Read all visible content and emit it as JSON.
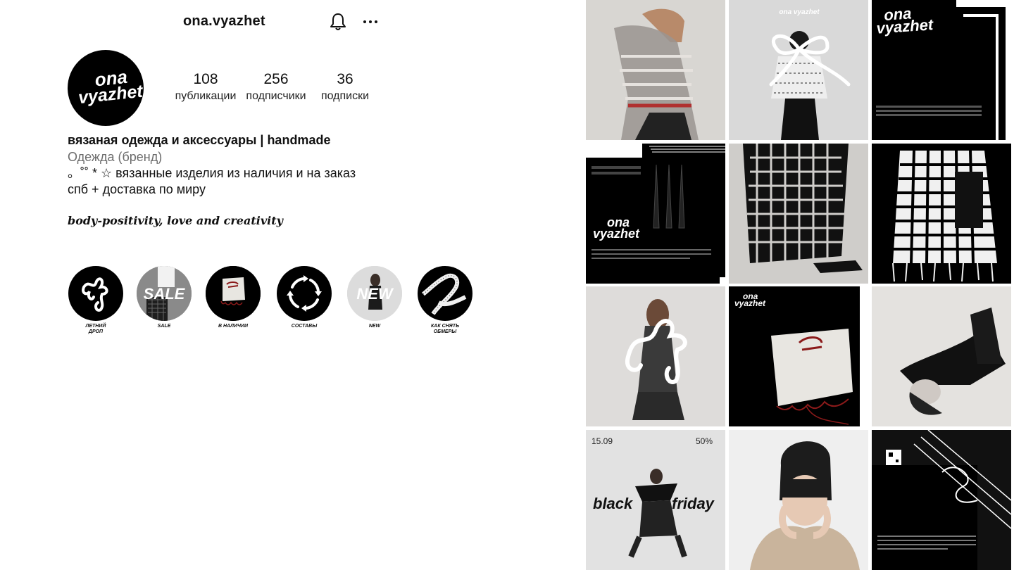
{
  "header": {
    "username": "ona.vyazhet",
    "bell_icon": "bell-icon",
    "more_icon": "more-horizontal-icon"
  },
  "avatar": {
    "logo_text_top": "ona",
    "logo_text_bottom": "vyazhet"
  },
  "stats": [
    {
      "value": "108",
      "label": "публикации"
    },
    {
      "value": "256",
      "label": "подписчики"
    },
    {
      "value": "36",
      "label": "подписки"
    }
  ],
  "bio": {
    "name": "вязаная одежда и аксессуары | handmade",
    "category": "Одежда (бренд)",
    "line1": "。˚˚ * ☆ вязанные изделия из наличия и на заказ",
    "line2": "спб + доставка по миру",
    "motto": "body-positivity, love and creativity"
  },
  "highlights": [
    {
      "label": "ЛЕТНИЙ\nДРОП",
      "icon": "squiggle-icon"
    },
    {
      "label": "SALE",
      "icon": "sale-image",
      "overlay": "SALE"
    },
    {
      "label": "В НАЛИЧИИ",
      "icon": "knit-top-image"
    },
    {
      "label": "СОСТАВЫ",
      "icon": "cycle-arrows-icon"
    },
    {
      "label": "NEW",
      "icon": "new-image",
      "overlay": "NEW"
    },
    {
      "label": "КАК СНЯТЬ\nОБМЕРЫ",
      "icon": "measuring-tape-icon"
    }
  ],
  "grid": {
    "tile3_logo_top": "ona",
    "tile3_logo_bottom": "vyazhet",
    "tile2_logo": "ona vyazhet",
    "tile4_logo_top": "ona",
    "tile4_logo_bottom": "vyazhet",
    "tile8_logo_top": "ona",
    "tile8_logo_bottom": "vyazhet",
    "tile10_date": "15.09",
    "tile10_discount": "50%",
    "tile10_word1": "black",
    "tile10_word2": "friday"
  },
  "colors": {
    "text": "#111111",
    "secondary": "#6b6b6b",
    "black": "#000000",
    "accent_red": "#8b1a1a"
  }
}
